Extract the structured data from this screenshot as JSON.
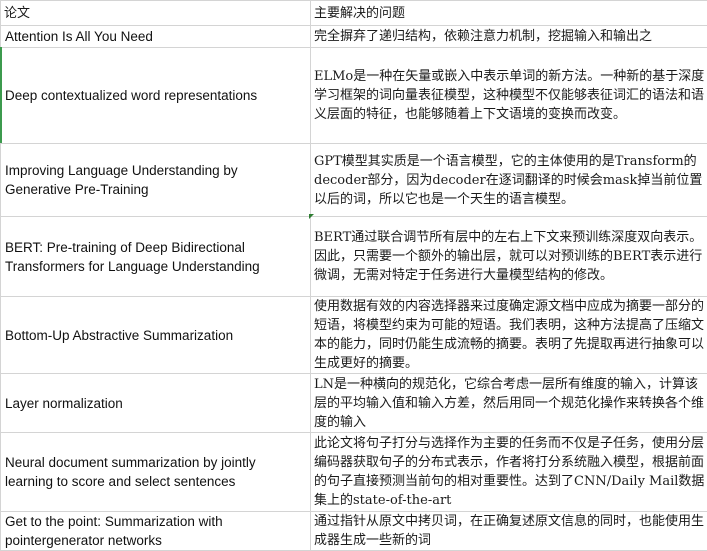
{
  "header": {
    "paper_col": "论文",
    "problem_col": "主要解决的问题"
  },
  "rows": [
    {
      "paper": "Attention Is All You Need",
      "problem": "完全摒弃了递归结构，依赖注意力机制，挖掘输入和输出之"
    },
    {
      "paper": "Deep contextualized word representations",
      "problem": "ELMo是一种在矢量或嵌入中表示单词的新方法。一种新的基于深度学习框架的词向量表征模型，这种模型不仅能够表征词汇的语法和语义层面的特征，也能够随着上下文语境的变换而改变。"
    },
    {
      "paper": "Improving Language Understanding by Generative Pre-Training",
      "problem": "GPT模型其实质是一个语言模型，它的主体使用的是Transform的decoder部分，因为decoder在逐词翻译的时候会mask掉当前位置以后的词，所以它也是一个天生的语言模型。"
    },
    {
      "paper": "BERT: Pre-training of Deep Bidirectional Transformers for Language Understanding",
      "problem": " BERT通过联合调节所有层中的左右上下文来预训练深度双向表示。因此，只需要一个额外的输出层，就可以对预训练的BERT表示进行微调，无需对特定于任务进行大量模型结构的修改。"
    },
    {
      "paper": "Bottom-Up Abstractive Summarization",
      "problem": "使用数据有效的内容选择器来过度确定源文档中应成为摘要一部分的短语，将模型约束为可能的短语。我们表明，这种方法提高了压缩文本的能力，同时仍能生成流畅的摘要。表明了先提取再进行抽象可以生成更好的摘要。"
    },
    {
      "paper": "Layer normalization",
      "problem": "LN是一种横向的规范化，它综合考虑一层所有维度的输入，计算该层的平均输入值和输入方差，然后用同一个规范化操作来转换各个维度的输入"
    },
    {
      "paper": "Neural document summarization by jointly learning to score and select sentences",
      "problem": "此论文将句子打分与选择作为主要的任务而不仅是子任务，使用分层编码器获取句子的分布式表示，作者将打分系统融入模型，根据前面的句子直接预测当前句的相对重要性。达到了CNN/Daily Mail数据集上的state-of-the-art"
    },
    {
      "paper": "Get to the point: Summarization with pointergenerator networks",
      "problem": "通过指针从原文中拷贝词，在正确复述原文信息的同时，也能使用生成器生成一些新的词"
    }
  ]
}
